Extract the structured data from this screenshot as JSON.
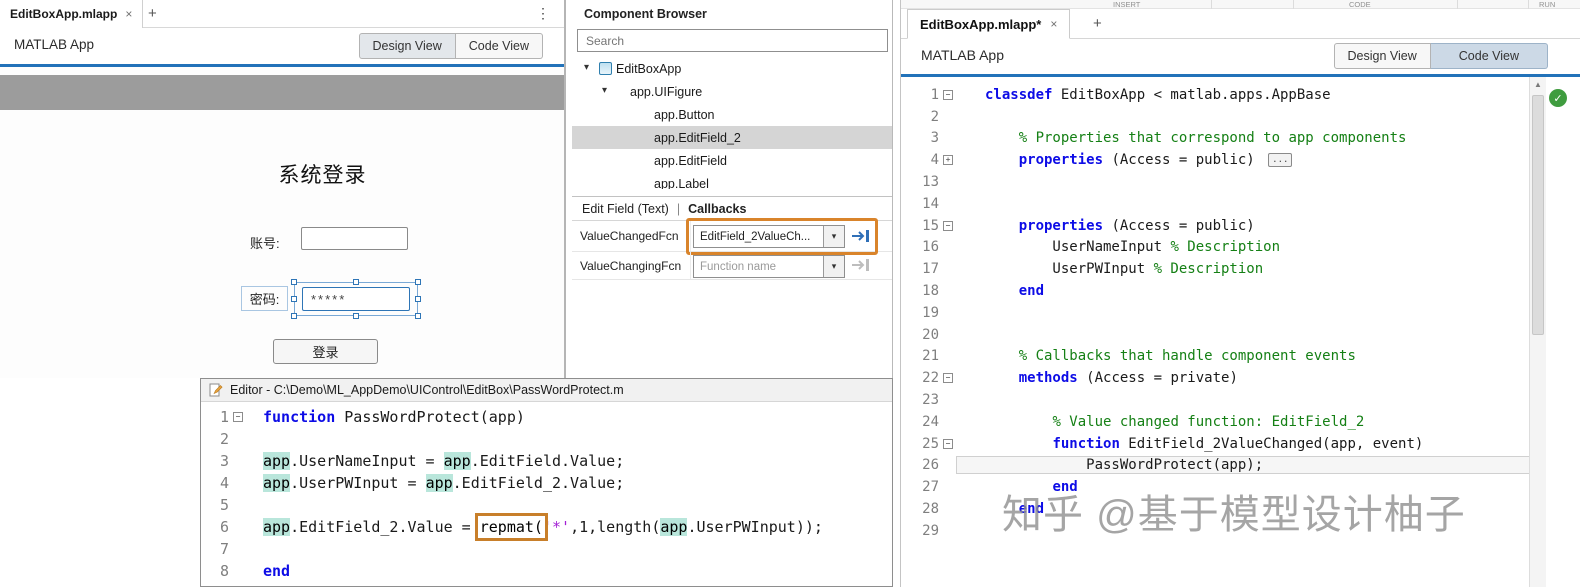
{
  "icons": {
    "chevron_down": "▾",
    "tree_expander": "▾",
    "up_arrow": "▲",
    "check": "✓",
    "close": "×",
    "add_tab": "+",
    "menu_dots": "⋮",
    "collapsed": "...",
    "fold_open": "−",
    "fold_closed": "+"
  },
  "colors": {
    "accent_orange": "#d9842b",
    "blue_divider": "#2272b9",
    "keyword": "#0d0ce6",
    "comment": "#158015",
    "string": "#a31fd4"
  },
  "left": {
    "tab": {
      "title": "EditBoxApp.mlapp"
    },
    "toolbar": {
      "app_title": "MATLAB App",
      "design_view": "Design View",
      "code_view": "Code View"
    },
    "canvas": {
      "heading": "系统登录",
      "account_label": "账号:",
      "password_label": "密码:",
      "password_value": "*****",
      "login_label": "登录"
    }
  },
  "browser": {
    "title": "Component Browser",
    "search_placeholder": "Search",
    "tree": [
      {
        "label": "EditBoxApp",
        "level": 0,
        "expander": true,
        "icon": true,
        "selected": false
      },
      {
        "label": "app.UIFigure",
        "level": 1,
        "expander": true,
        "icon": false,
        "selected": false
      },
      {
        "label": "app.Button",
        "level": 2,
        "expander": false,
        "icon": false,
        "selected": false
      },
      {
        "label": "app.EditField_2",
        "level": 2,
        "expander": false,
        "icon": false,
        "selected": true
      },
      {
        "label": "app.EditField",
        "level": 2,
        "expander": false,
        "icon": false,
        "selected": false
      },
      {
        "label": "app.Label",
        "level": 2,
        "expander": false,
        "icon": false,
        "selected": false
      }
    ],
    "tabs": [
      {
        "label": "Edit Field (Text)",
        "active": false
      },
      {
        "label": "Callbacks",
        "active": true
      }
    ],
    "tab_separator": "|",
    "properties": [
      {
        "name": "ValueChangedFcn",
        "value": "EditField_2ValueCh...",
        "placeholder": false,
        "highlighted": true,
        "goto_enabled": true
      },
      {
        "name": "ValueChangingFcn",
        "value": "Function name",
        "placeholder": true,
        "highlighted": false,
        "goto_enabled": false
      }
    ]
  },
  "editor_window": {
    "title": "Editor - C:\\Demo\\ML_AppDemo\\UIControl\\EditBox\\PassWordProtect.m"
  },
  "right": {
    "ribbon": [
      "INSERT",
      "CODE",
      "RUN"
    ],
    "tab": {
      "title": "EditBoxApp.mlapp*"
    },
    "toolbar": {
      "app_title": "MATLAB App",
      "design_view": "Design View",
      "code_view": "Code View"
    },
    "status_ok": "✓"
  },
  "editors": {
    "passwordprotect": {
      "lines": [
        {
          "n": "1",
          "fold": "open",
          "segs": [
            [
              "function ",
              "kw"
            ],
            [
              "PassWordProtect(app)",
              "pl"
            ]
          ]
        },
        {
          "n": "2",
          "segs": []
        },
        {
          "n": "3",
          "segs": [
            [
              "app",
              "hl"
            ],
            [
              ".UserNameInput = ",
              "pl"
            ],
            [
              "app",
              "hl"
            ],
            [
              ".EditField.Value;",
              "pl"
            ]
          ]
        },
        {
          "n": "4",
          "segs": [
            [
              "app",
              "hl"
            ],
            [
              ".UserPWInput = ",
              "pl"
            ],
            [
              "app",
              "hl"
            ],
            [
              ".EditField_2.Value;",
              "pl"
            ]
          ]
        },
        {
          "n": "5",
          "segs": []
        },
        {
          "n": "6",
          "segs": [
            [
              "app",
              "hl"
            ],
            [
              ".EditField_2.Value = ",
              "pl"
            ],
            [
              "repmat(",
              "box"
            ],
            [
              "'*'",
              "str"
            ],
            [
              ",1,length(",
              "pl"
            ],
            [
              "app",
              "hl"
            ],
            [
              ".UserPWInput));",
              "pl"
            ]
          ]
        },
        {
          "n": "7",
          "segs": []
        },
        {
          "n": "8",
          "segs": [
            [
              "end",
              "kw"
            ]
          ]
        }
      ]
    },
    "classdef": {
      "lines": [
        {
          "n": "1",
          "fold": "open",
          "segs": [
            [
              "classdef ",
              "kw"
            ],
            [
              "EditBoxApp < matlab.apps.AppBase",
              "pl"
            ]
          ]
        },
        {
          "n": "2",
          "segs": []
        },
        {
          "n": "3",
          "segs": [
            [
              "    ",
              "pl"
            ],
            [
              "% Properties that correspond to app components",
              "cm"
            ]
          ]
        },
        {
          "n": "4",
          "fold": "closed",
          "collapsed": true,
          "segs": [
            [
              "    ",
              "pl"
            ],
            [
              "properties ",
              "kw"
            ],
            [
              "(Access = public) ",
              "pl"
            ]
          ]
        },
        {
          "n": "13",
          "segs": []
        },
        {
          "n": "14",
          "segs": []
        },
        {
          "n": "15",
          "fold": "open",
          "segs": [
            [
              "    ",
              "pl"
            ],
            [
              "properties ",
              "kw"
            ],
            [
              "(Access = public)",
              "pl"
            ]
          ]
        },
        {
          "n": "16",
          "segs": [
            [
              "        UserNameInput ",
              "pl"
            ],
            [
              "% Description",
              "cm"
            ]
          ]
        },
        {
          "n": "17",
          "segs": [
            [
              "        UserPWInput ",
              "pl"
            ],
            [
              "% Description",
              "cm"
            ]
          ]
        },
        {
          "n": "18",
          "segs": [
            [
              "    ",
              "pl"
            ],
            [
              "end",
              "kw"
            ]
          ]
        },
        {
          "n": "19",
          "segs": []
        },
        {
          "n": "20",
          "segs": []
        },
        {
          "n": "21",
          "segs": [
            [
              "    ",
              "pl"
            ],
            [
              "% Callbacks that handle component events",
              "cm"
            ]
          ]
        },
        {
          "n": "22",
          "fold": "open",
          "segs": [
            [
              "    ",
              "pl"
            ],
            [
              "methods ",
              "kw"
            ],
            [
              "(Access = private)",
              "pl"
            ]
          ]
        },
        {
          "n": "23",
          "segs": []
        },
        {
          "n": "24",
          "segs": [
            [
              "        ",
              "pl"
            ],
            [
              "% Value changed function: EditField_2",
              "cm"
            ]
          ]
        },
        {
          "n": "25",
          "fold": "open",
          "segs": [
            [
              "        ",
              "pl"
            ],
            [
              "function ",
              "kw"
            ],
            [
              "EditField_2ValueChanged(app, event)",
              "pl"
            ]
          ]
        },
        {
          "n": "26",
          "current": true,
          "segs": [
            [
              "            PassWordProtect(app);",
              "pl"
            ]
          ]
        },
        {
          "n": "27",
          "segs": [
            [
              "        ",
              "pl"
            ],
            [
              "end",
              "kw"
            ]
          ]
        },
        {
          "n": "28",
          "segs": [
            [
              "    ",
              "pl"
            ],
            [
              "end",
              "kw"
            ]
          ]
        },
        {
          "n": "29",
          "segs": []
        }
      ]
    }
  },
  "watermark": "知乎 @基于模型设计柚子"
}
